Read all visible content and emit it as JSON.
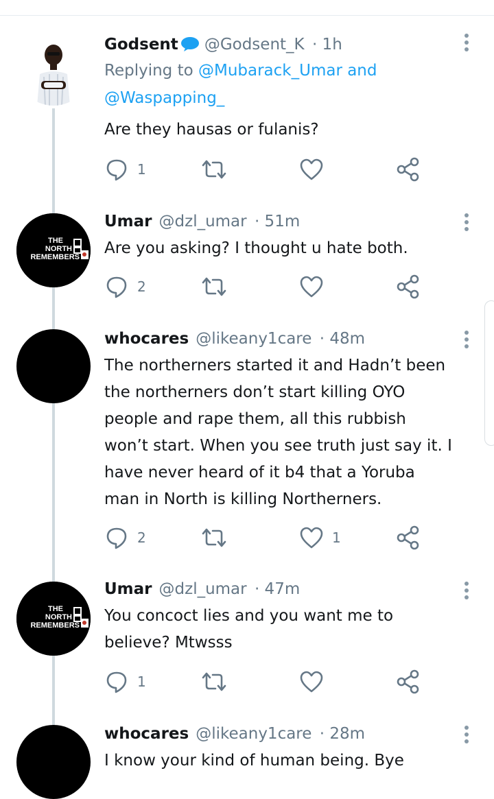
{
  "colors": {
    "link": "#1da1f2",
    "meta": "#657786",
    "text": "#14171a",
    "icon": "#657786",
    "thread_line": "#cfd9de"
  },
  "icons": {
    "reply": "reply-icon",
    "retweet": "retweet-icon",
    "like": "heart-icon",
    "share": "share-icon",
    "more": "more-vertical-icon",
    "verified": "verified-badge-icon"
  },
  "tweets": [
    {
      "name": "Godsent",
      "handle": "@Godsent_K",
      "time": "· 1h",
      "replying_prefix": "Replying to ",
      "reply_user_1": "@Mubarack_Umar",
      "reply_and": " and",
      "reply_user_2": "@Waspapping_",
      "text": "Are they hausas or fulanis?",
      "reply_count": "1",
      "like_count": ""
    },
    {
      "name": "Umar",
      "handle": "@dzl_umar",
      "time": "· 51m",
      "text": "Are you asking? I thought u hate both.",
      "reply_count": "2",
      "like_count": ""
    },
    {
      "name": "whocares",
      "handle": "@likeany1care",
      "time": "· 48m",
      "text": "The northerners started it and Hadn’t been the northerners don’t start killing OYO people and rape them, all this rubbish won’t start. When you see truth just say it. I have never heard of it b4 that a Yoruba man in North is killing Northerners.",
      "reply_count": "2",
      "like_count": "1"
    },
    {
      "name": "Umar",
      "handle": "@dzl_umar",
      "time": "· 47m",
      "text": "You concoct lies and you  want me to believe? Mtwsss",
      "reply_count": "1",
      "like_count": ""
    },
    {
      "name": "whocares",
      "handle": "@likeany1care",
      "time": "· 28m",
      "text": "I know your kind of human being. Bye"
    }
  ],
  "avatar_logo": {
    "line1": "THE",
    "line2": "NORTH",
    "line3": "REMEMBERS"
  }
}
